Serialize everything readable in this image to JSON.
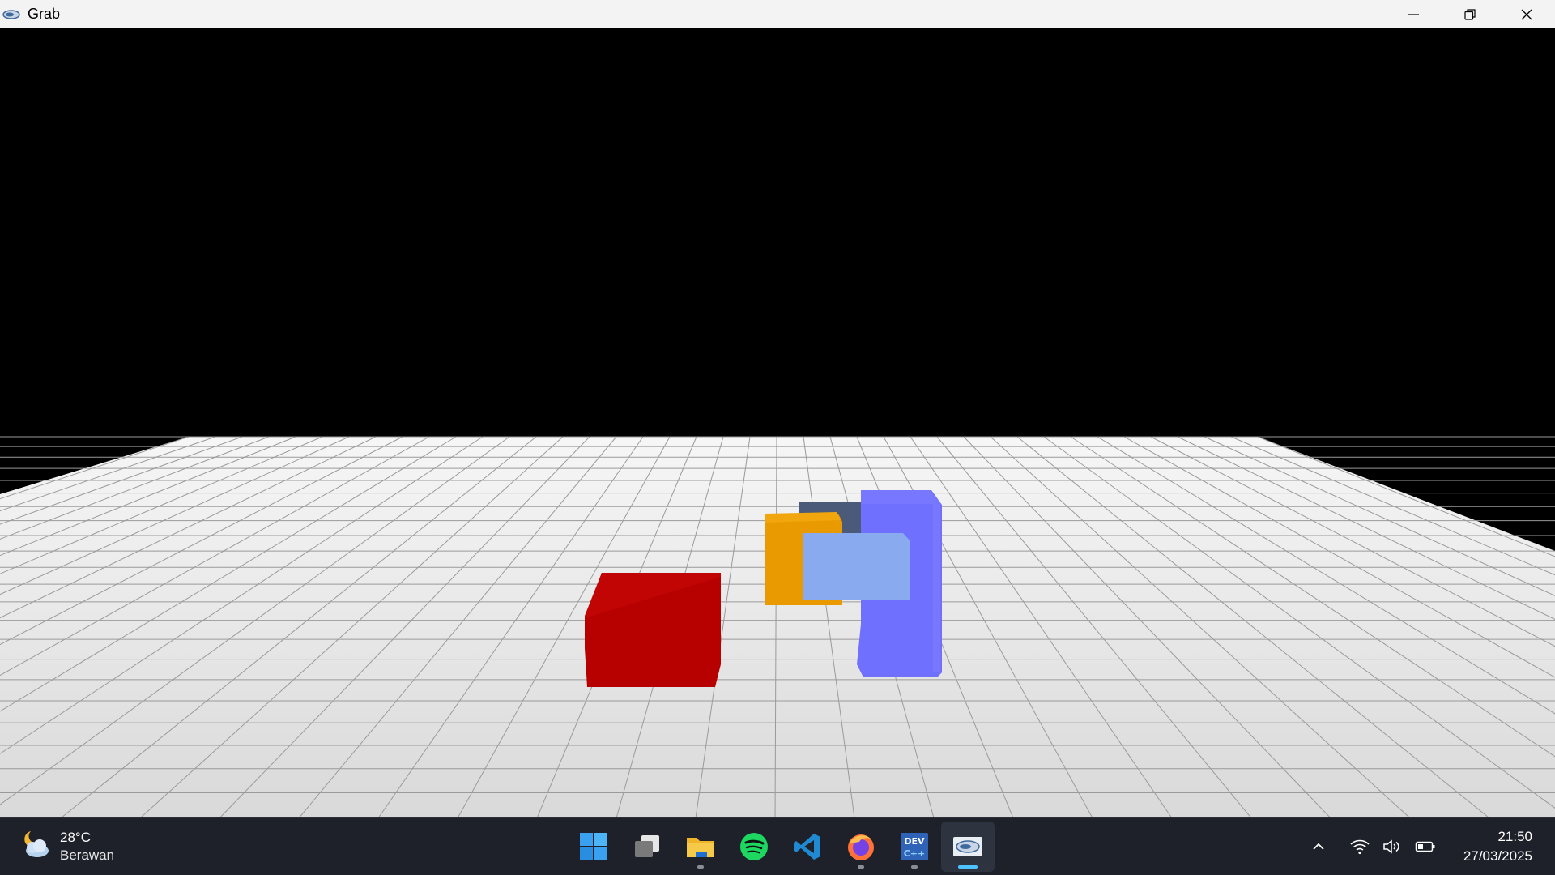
{
  "window": {
    "title": "Grab",
    "app_icon": "opengl-app-icon",
    "controls": [
      "minimize-icon",
      "restore-icon",
      "close-icon"
    ]
  },
  "scene": {
    "background": "#000000",
    "floor_color": "#e6e6e6",
    "grid_line_color": "#9a9a9a",
    "cubes": [
      {
        "name": "red-cube",
        "color": "#b70000"
      },
      {
        "name": "orange-cube",
        "color": "#e89a00"
      },
      {
        "name": "dark-slate-cube",
        "color": "#4a5a78"
      },
      {
        "name": "light-blue-cube",
        "color": "#8aaaf0"
      },
      {
        "name": "blue-violet-cube",
        "color": "#7070ff"
      }
    ]
  },
  "taskbar": {
    "weather": {
      "temperature": "28°C",
      "condition": "Berawan",
      "icon": "partly-cloudy-night-icon"
    },
    "apps": [
      {
        "name": "start",
        "icon": "windows-start-icon"
      },
      {
        "name": "task-view",
        "icon": "task-view-icon"
      },
      {
        "name": "file-explorer",
        "icon": "folder-icon"
      },
      {
        "name": "spotify",
        "icon": "spotify-icon"
      },
      {
        "name": "vscode",
        "icon": "vscode-icon"
      },
      {
        "name": "firefox",
        "icon": "firefox-icon"
      },
      {
        "name": "dev-cpp",
        "icon": "dev-cpp-icon"
      },
      {
        "name": "opengl-app",
        "icon": "opengl-app-icon"
      }
    ],
    "tray": {
      "icons": [
        "chevron-up-icon",
        "wifi-icon",
        "volume-icon",
        "battery-icon"
      ]
    },
    "clock": {
      "time": "21:50",
      "date": "27/03/2025"
    },
    "accent_color": "#4cc2ff"
  }
}
